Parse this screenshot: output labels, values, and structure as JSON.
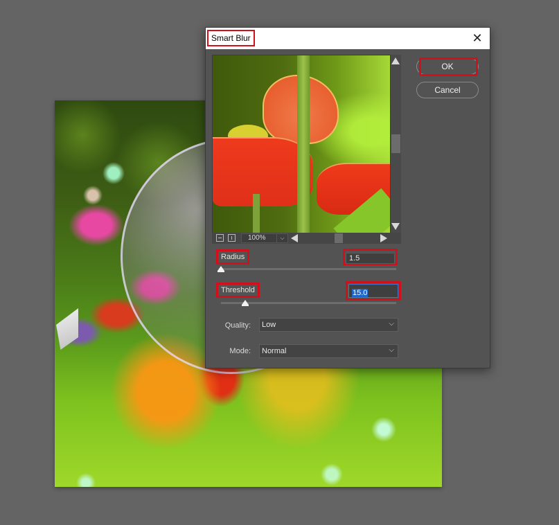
{
  "dialog": {
    "title": "Smart Blur",
    "close_glyph": "✕"
  },
  "preview": {
    "zoom_level": "100%",
    "zoom_chevron": "⌵",
    "zoom_out_icon": "zoom-out",
    "zoom_in_icon": "zoom-in"
  },
  "buttons": {
    "ok": "OK",
    "cancel": "Cancel"
  },
  "params": {
    "radius": {
      "label": "Radius",
      "value": "1.5",
      "slider_fraction": 0.0
    },
    "threshold": {
      "label": "Threshold",
      "value": "15.0",
      "slider_fraction": 0.14
    }
  },
  "options": {
    "quality": {
      "label": "Quality:",
      "value": "Low"
    },
    "mode": {
      "label": "Mode:",
      "value": "Normal"
    },
    "chevron": "⌵"
  },
  "highlight_color": "#d0101a"
}
